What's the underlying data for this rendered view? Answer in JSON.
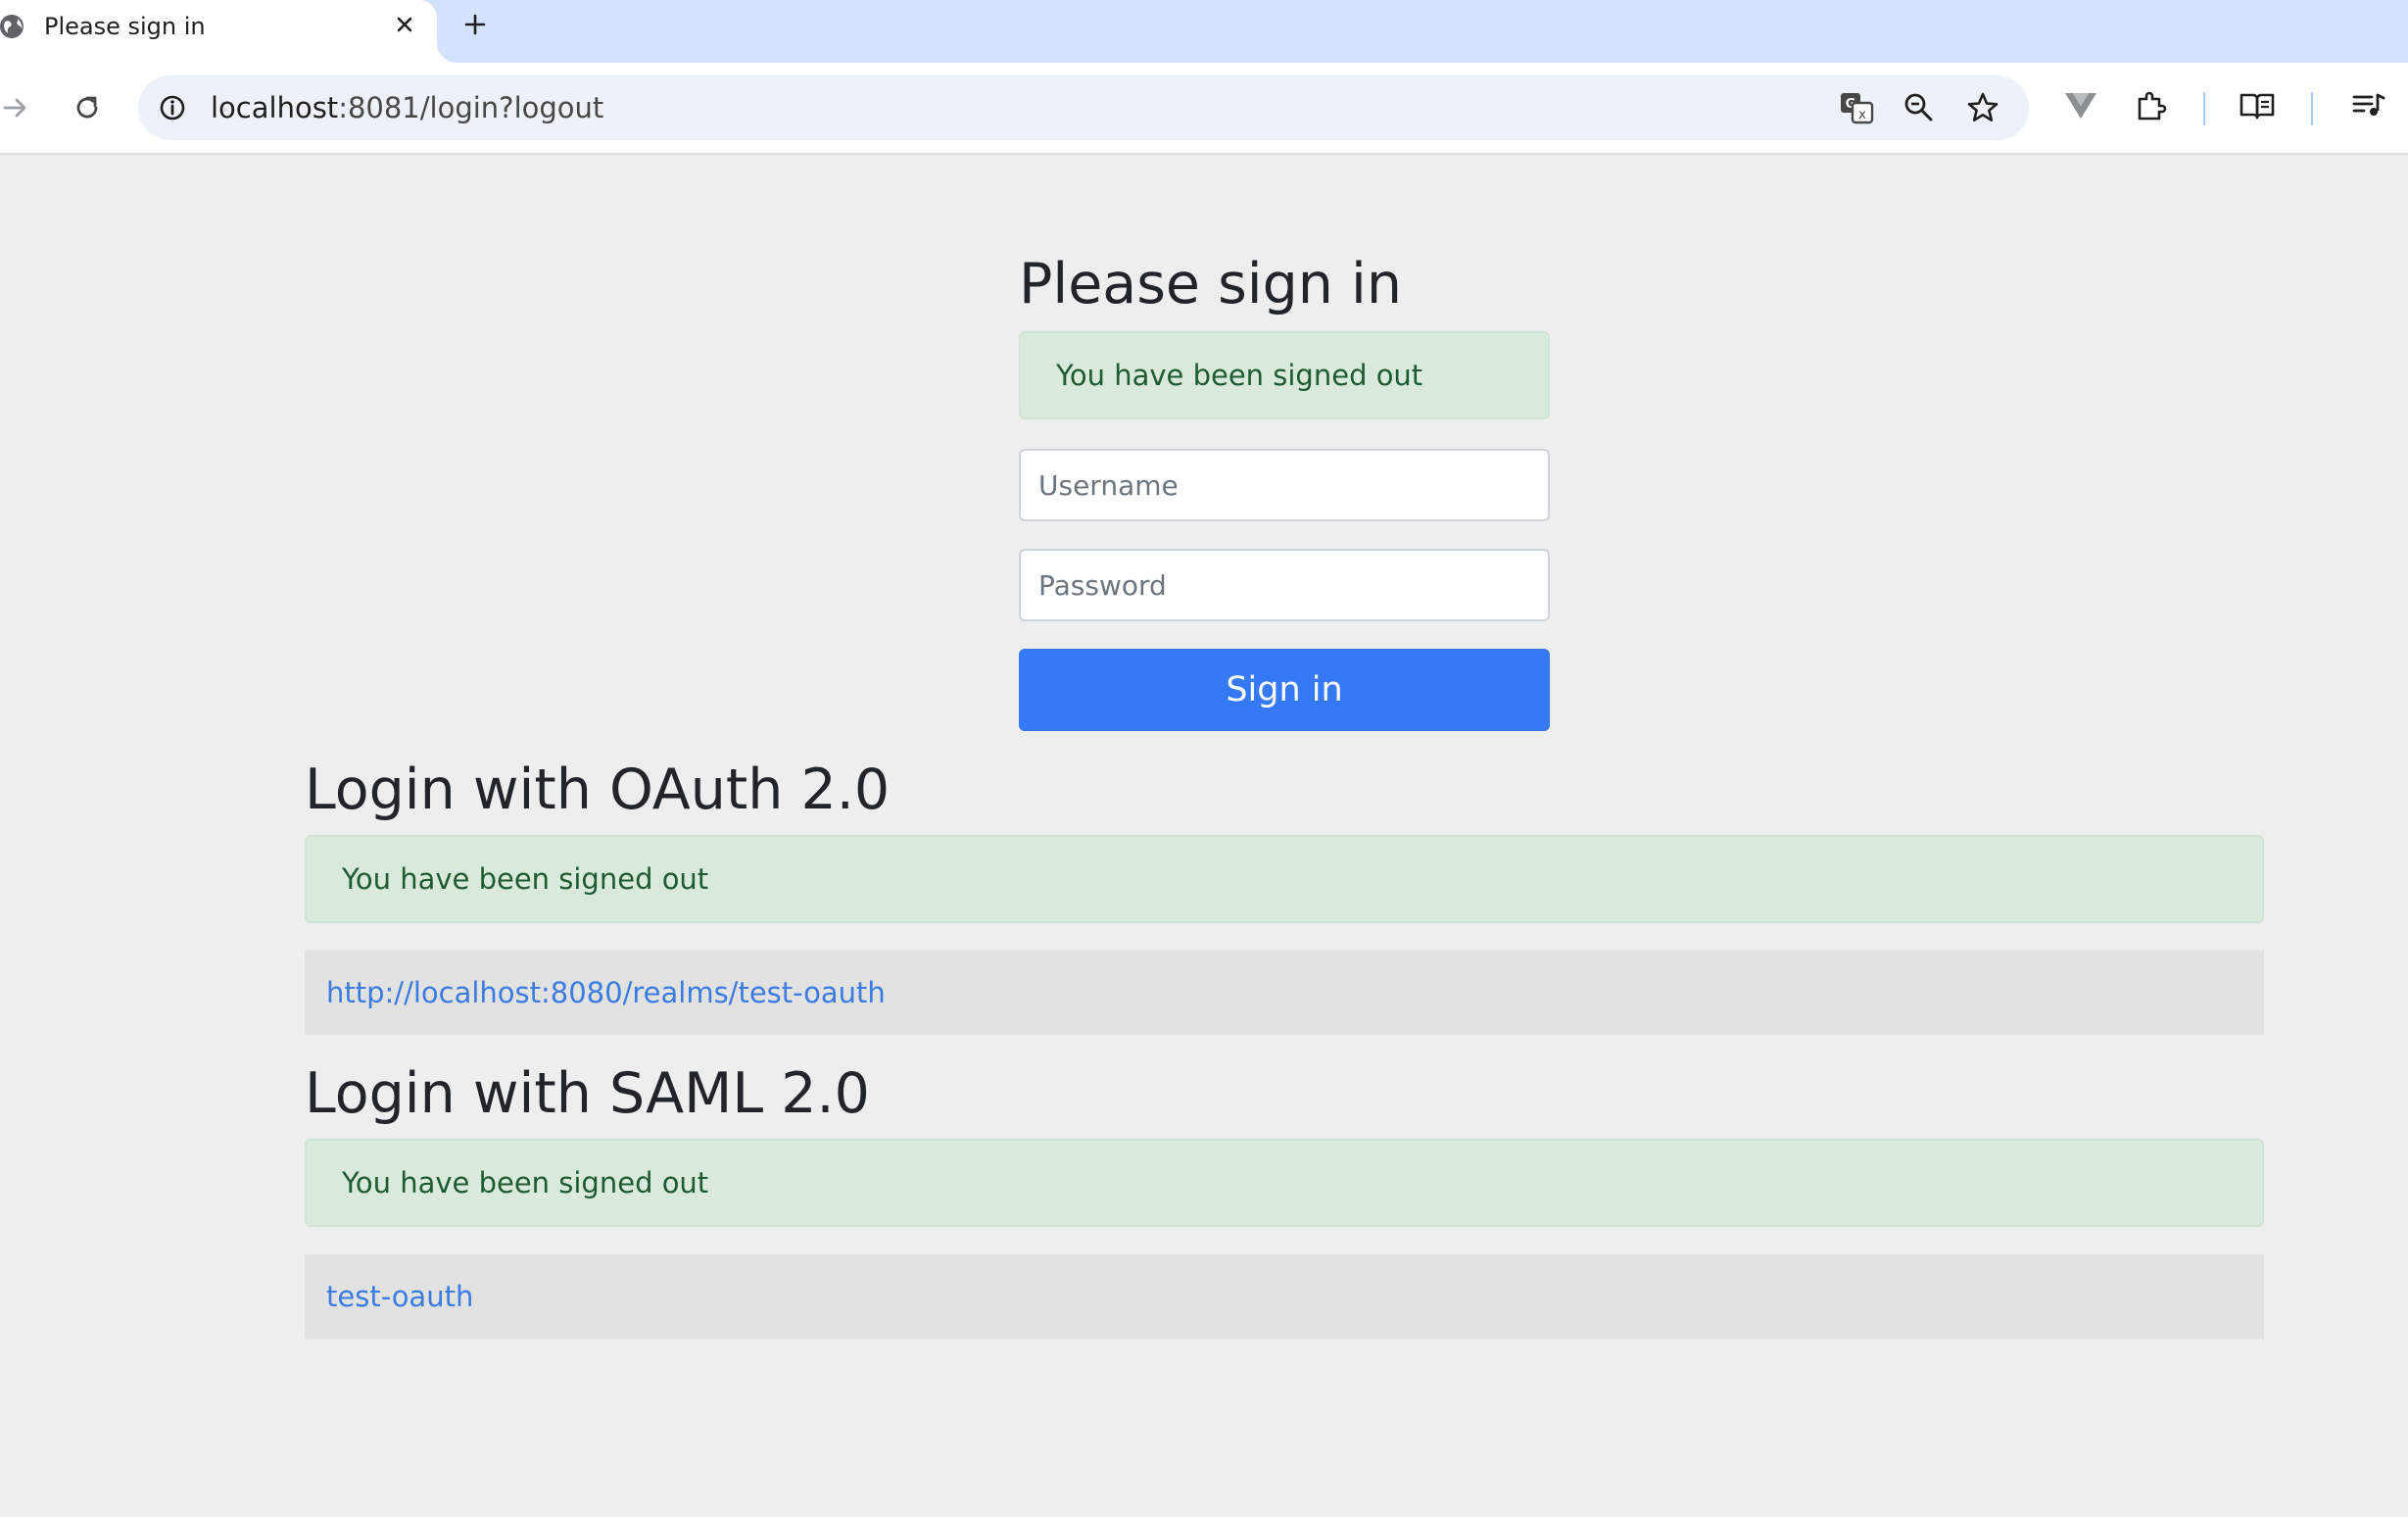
{
  "browser": {
    "tab_title": "Please sign in",
    "url_host": "localhost",
    "url_path": ":8081/login?logout"
  },
  "signin": {
    "heading": "Please sign in",
    "alert": "You have been signed out",
    "username_placeholder": "Username",
    "password_placeholder": "Password",
    "button_label": "Sign in"
  },
  "oauth": {
    "heading": "Login with OAuth 2.0",
    "alert": "You have been signed out",
    "links": [
      "http://localhost:8080/realms/test-oauth"
    ]
  },
  "saml": {
    "heading": "Login with SAML 2.0",
    "alert": "You have been signed out",
    "links": [
      "test-oauth"
    ]
  },
  "colors": {
    "primary": "#3579f6",
    "success_bg": "#d9eadd",
    "link": "#3a7be4",
    "tabstrip": "#d3e3fd"
  }
}
